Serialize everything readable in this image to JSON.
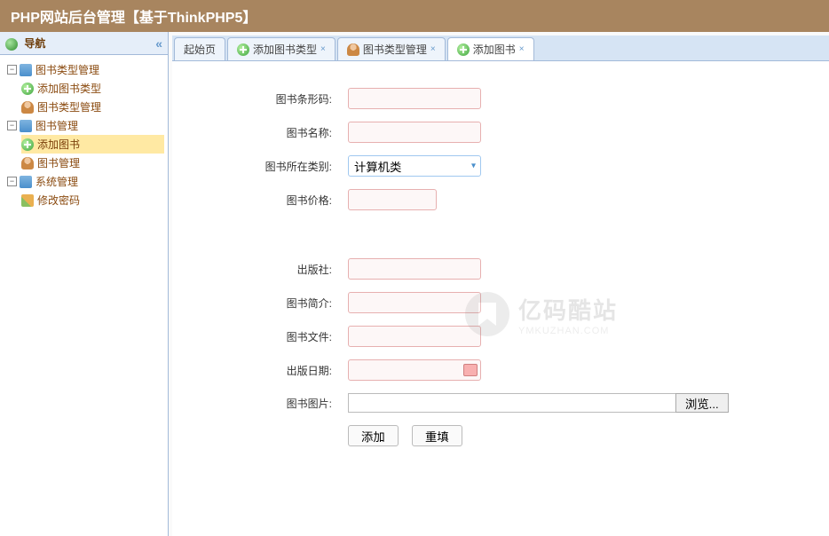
{
  "header": {
    "title": "PHP网站后台管理【基于ThinkPHP5】"
  },
  "sidebar": {
    "title": "导航",
    "groups": [
      {
        "label": "图书类型管理",
        "children": [
          {
            "label": "添加图书类型",
            "icon": "add"
          },
          {
            "label": "图书类型管理",
            "icon": "user"
          }
        ]
      },
      {
        "label": "图书管理",
        "children": [
          {
            "label": "添加图书",
            "icon": "add",
            "selected": true
          },
          {
            "label": "图书管理",
            "icon": "user"
          }
        ]
      },
      {
        "label": "系统管理",
        "children": [
          {
            "label": "修改密码",
            "icon": "pencil"
          }
        ]
      }
    ]
  },
  "tabs": [
    {
      "label": "起始页",
      "icon": "none",
      "closable": false
    },
    {
      "label": "添加图书类型",
      "icon": "add",
      "closable": true
    },
    {
      "label": "图书类型管理",
      "icon": "user",
      "closable": true
    },
    {
      "label": "添加图书",
      "icon": "add",
      "closable": true,
      "active": true
    }
  ],
  "form": {
    "fields": {
      "barcode": "图书条形码:",
      "name": "图书名称:",
      "category": "图书所在类别:",
      "price": "图书价格:",
      "publisher": "出版社:",
      "intro": "图书简介:",
      "file": "图书文件:",
      "date": "出版日期:",
      "image": "图书图片:"
    },
    "category_value": "计算机类",
    "browse_label": "浏览...",
    "submit_label": "添加",
    "reset_label": "重填"
  },
  "watermark": {
    "cn": "亿码酷站",
    "en": "YMKUZHAN.COM"
  }
}
